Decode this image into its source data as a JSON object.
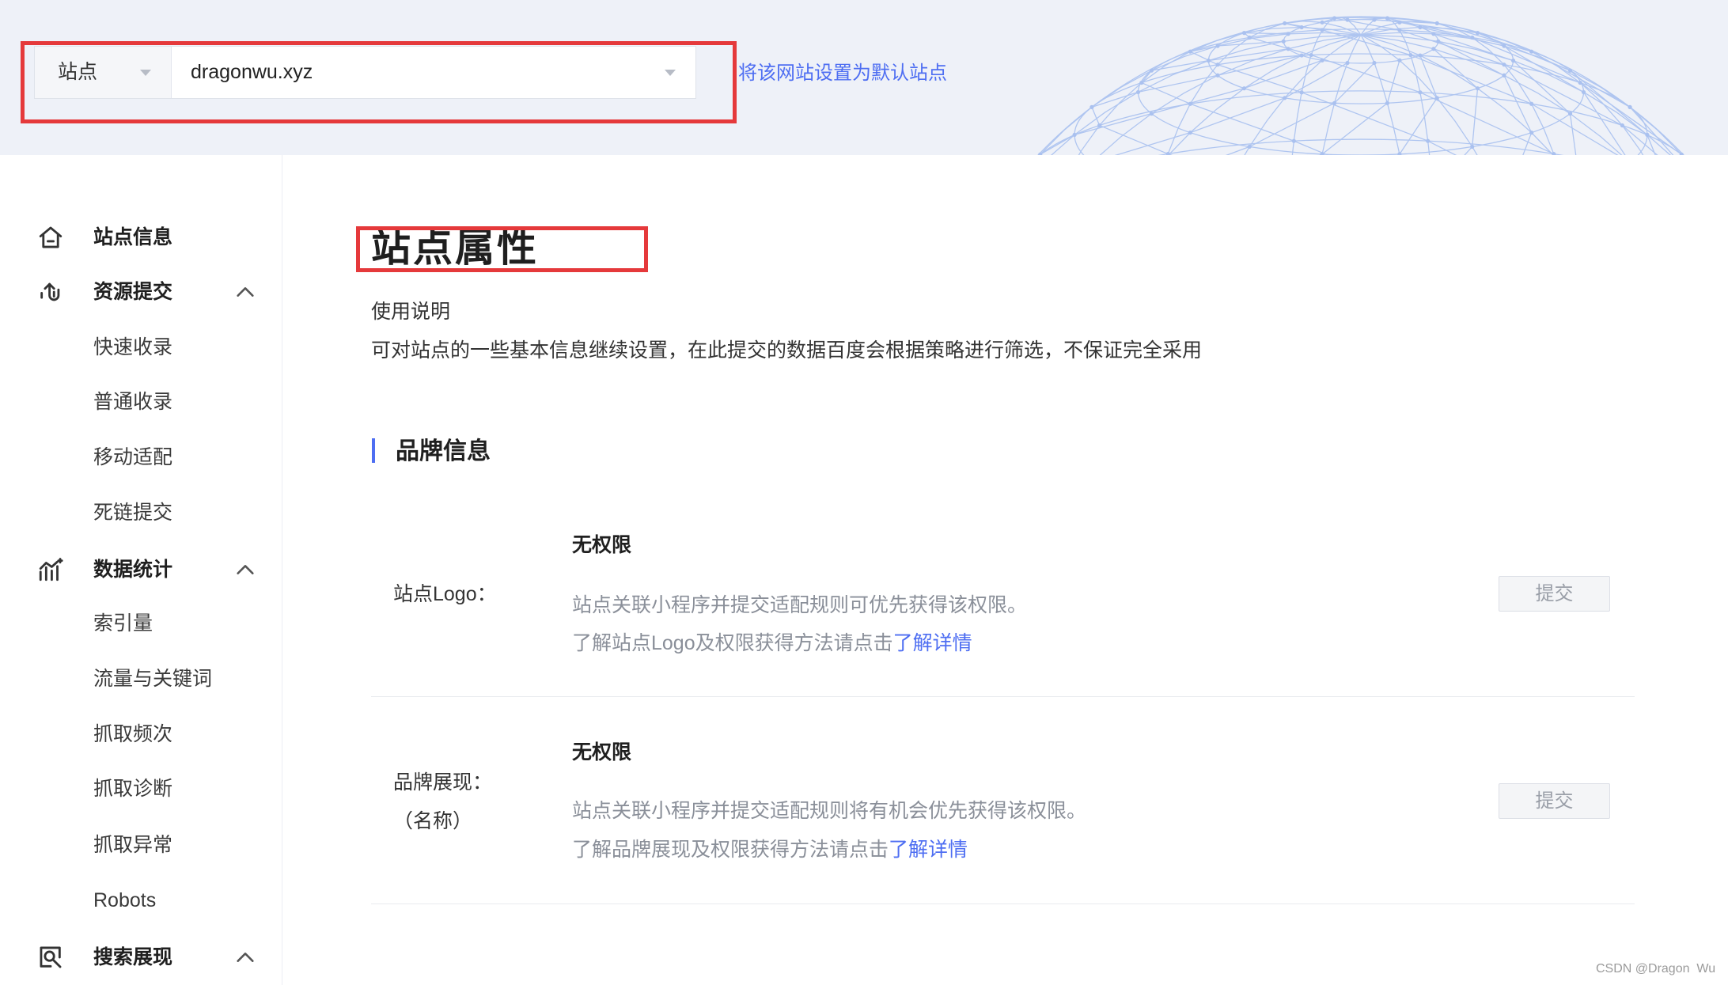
{
  "header": {
    "site_label": "站点",
    "site_value": "dragonwu.xyz",
    "set_default_link": "将该网站设置为默认站点"
  },
  "sidebar": {
    "groups": [
      {
        "label": "站点信息",
        "icon": "home-icon"
      },
      {
        "label": "资源提交",
        "icon": "resource-submit-icon",
        "expanded": true,
        "children": [
          "快速收录",
          "普通收录",
          "移动适配",
          "死链提交"
        ]
      },
      {
        "label": "数据统计",
        "icon": "data-stats-icon",
        "expanded": true,
        "children": [
          "索引量",
          "流量与关键词",
          "抓取频次",
          "抓取诊断",
          "抓取异常",
          "Robots"
        ]
      },
      {
        "label": "搜索展现",
        "icon": "search-display-icon",
        "expanded": true
      }
    ]
  },
  "main": {
    "title": "站点属性",
    "usage_title": "使用说明",
    "usage_text": "可对站点的一些基本信息继续设置，在此提交的数据百度会根据策略进行筛选，不保证完全采用",
    "section_title": "品牌信息",
    "rows": [
      {
        "label": "站点Logo：",
        "status": "无权限",
        "desc": "站点关联小程序并提交适配规则可优先获得该权限。",
        "help_prefix": "了解站点Logo及权限获得方法请点击",
        "help_link": "了解详情",
        "button": "提交"
      },
      {
        "label": "品牌展现：",
        "sublabel": "（名称）",
        "status": "无权限",
        "desc": "站点关联小程序并提交适配规则将有机会优先获得该权限。",
        "help_prefix": "了解品牌展现及权限获得方法请点击",
        "help_link": "了解详情",
        "button": "提交"
      }
    ]
  },
  "watermark": "CSDN @Dragon  Wu",
  "colors": {
    "accent": "#4e6ef2",
    "annotation_red": "#e5393b",
    "top_bar_bg": "#eef1f8",
    "muted_text": "#8a8f99"
  }
}
